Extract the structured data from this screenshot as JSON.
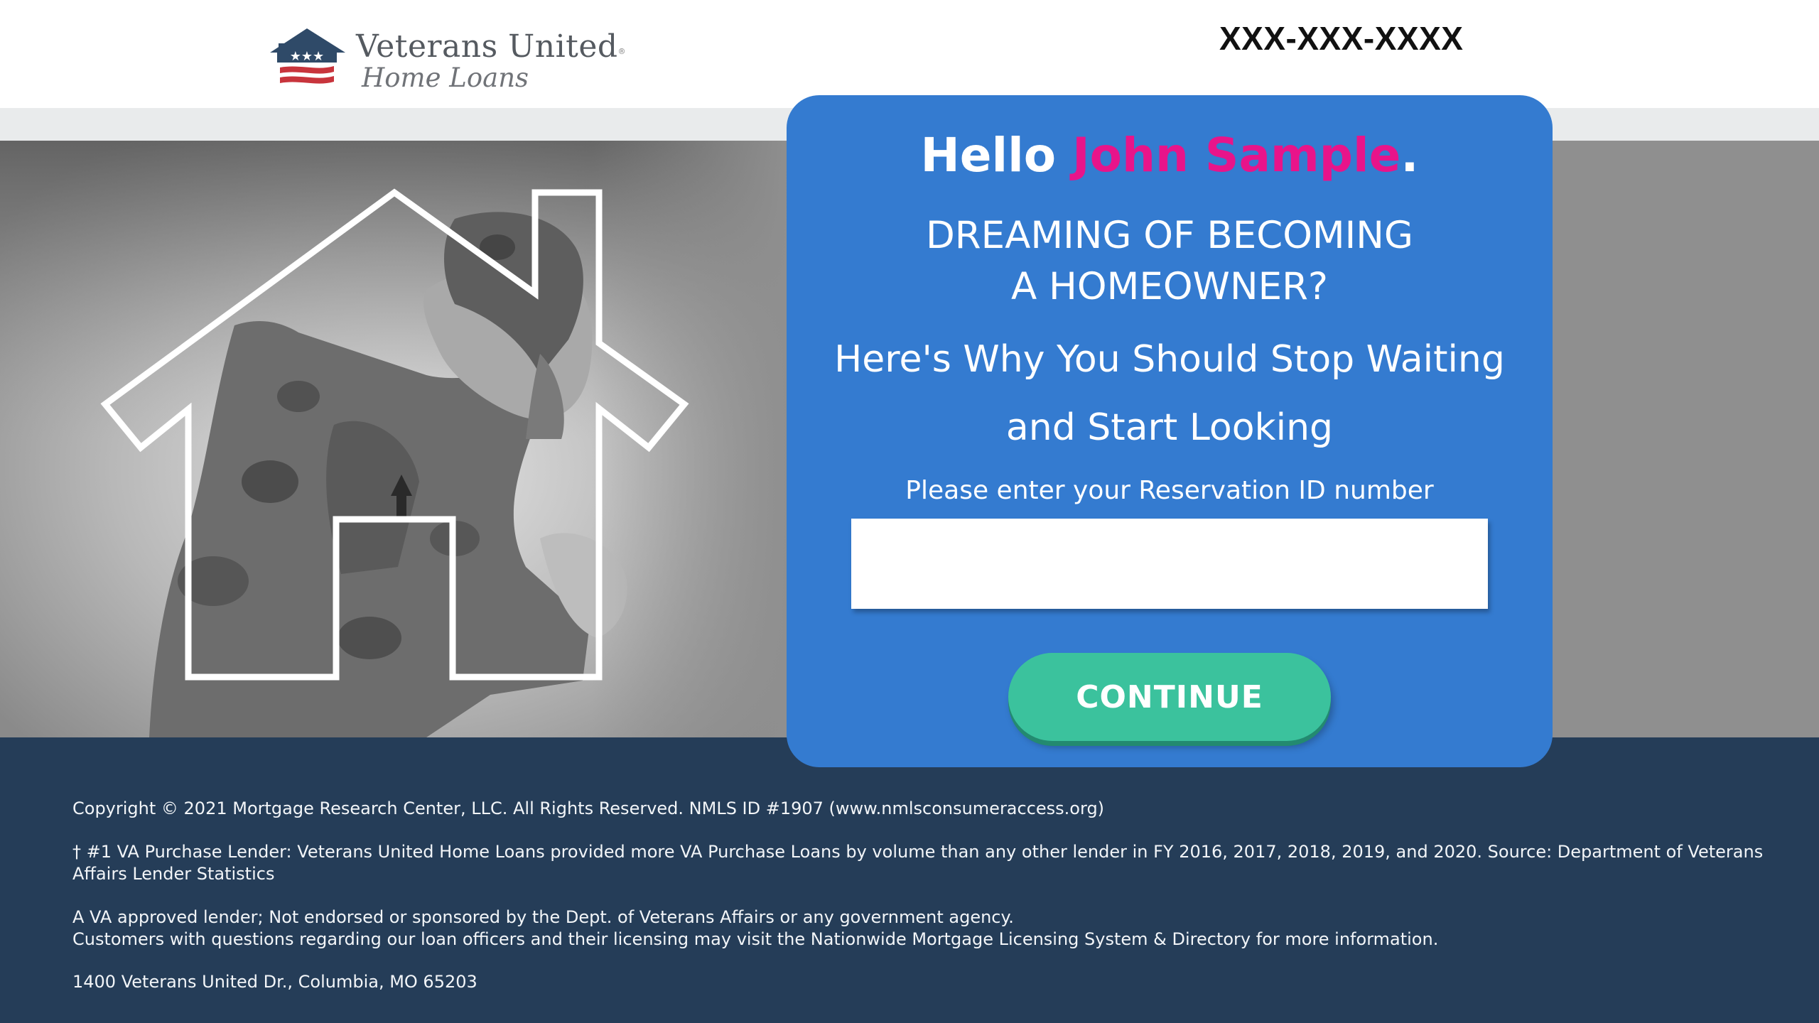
{
  "header": {
    "logo": {
      "name": "Veterans United",
      "registered": "®",
      "subname": "Home Loans"
    },
    "phone": "XXX-XXX-XXXX"
  },
  "card": {
    "greeting": "Hello",
    "name": "John Sample",
    "greeting_end": ".",
    "headline_line1": "DREAMING OF BECOMING",
    "headline_line2": "A HOMEOWNER?",
    "subhead_line1": "Here's Why You Should Stop Waiting",
    "subhead_line2": "and Start Looking",
    "input_label": "Please enter your Reservation ID number",
    "input_value": "",
    "input_placeholder": "",
    "button_label": "CONTINUE"
  },
  "footer": {
    "copyright": "Copyright © 2021 Mortgage Research Center, LLC. All Rights Reserved. NMLS ID #1907 (www.nmlsconsumeraccess.org)",
    "disclaimer": "† #1 VA Purchase Lender: Veterans United Home Loans provided more VA Purchase Loans by volume than any other lender in FY 2016, 2017, 2018, 2019, and 2020. Source: Department of Veterans Affairs Lender Statistics",
    "approved": "A VA approved lender; Not endorsed or sponsored by the Dept. of Veterans Affairs or any government agency.",
    "customers": "Customers with questions regarding our loan officers and their licensing may visit the Nationwide Mortgage Licensing System & Directory for more information.",
    "address": "1400 Veterans United Dr., Columbia, MO 65203"
  },
  "colors": {
    "card_blue": "#347bd0",
    "name_pink": "#e8148a",
    "button_green": "#3bc29d",
    "footer_navy": "#253d58",
    "logo_navy": "#2f4a68",
    "logo_red": "#c8343c"
  },
  "icons": {
    "logo_mark": "house-flag-icon",
    "hero_outline": "house-outline-icon"
  }
}
